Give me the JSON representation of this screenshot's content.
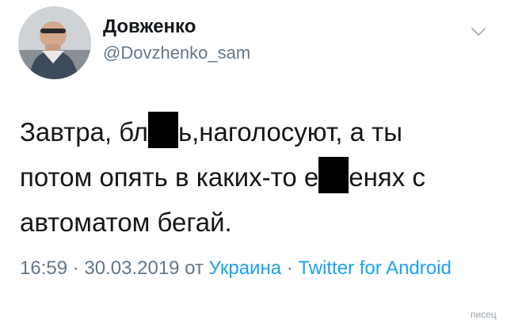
{
  "author": {
    "display_name": "Довженко",
    "handle": "@Dovzhenko_sam",
    "avatar_icon": "profile-photo"
  },
  "menu_icon": "chevron-down-icon",
  "tweet": {
    "line1_a": "Завтра, бл",
    "line1_b": "ь,наголосуют, а ты",
    "line2_a": "потом опять в каких-то е",
    "line2_b": "енях с",
    "line3": "автоматом бегай."
  },
  "meta": {
    "time": "16:59",
    "sep1": " · ",
    "date": "30.03.2019",
    "from": " от ",
    "location": "Украина",
    "sep2": " · ",
    "source": "Twitter for Android"
  },
  "watermark": "писец",
  "colors": {
    "text": "#14171a",
    "muted": "#657786",
    "link": "#1da1f2",
    "censor": "#000000"
  }
}
